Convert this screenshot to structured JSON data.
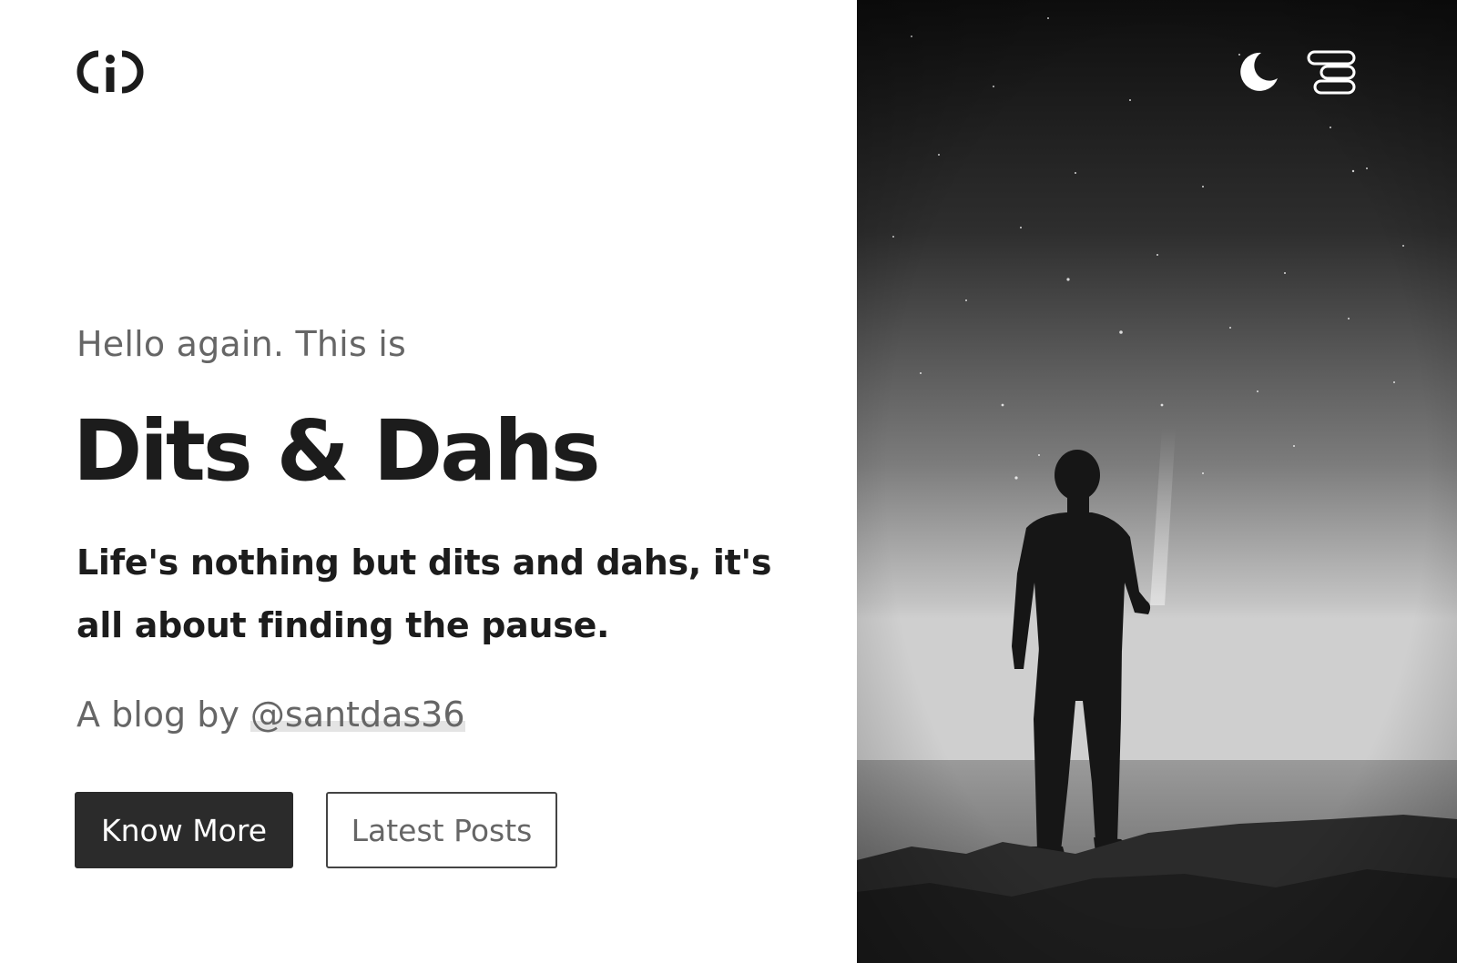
{
  "header": {
    "logo_icon": "cid-logo-icon",
    "theme_toggle_icon": "moon-icon",
    "menu_icon": "menu-icon"
  },
  "hero": {
    "greeting": "Hello again. This is",
    "title": "Dits & Dahs",
    "tagline": "Life's nothing but dits and dahs, it's all about finding the pause.",
    "byline_prefix": "A blog by ",
    "byline_handle": "@santdas36"
  },
  "buttons": {
    "know_more": "Know More",
    "latest_posts": "Latest Posts"
  },
  "colors": {
    "primary_button_bg": "#2b2b2b",
    "text_dark": "#1c1c1c",
    "text_muted": "#666666"
  }
}
